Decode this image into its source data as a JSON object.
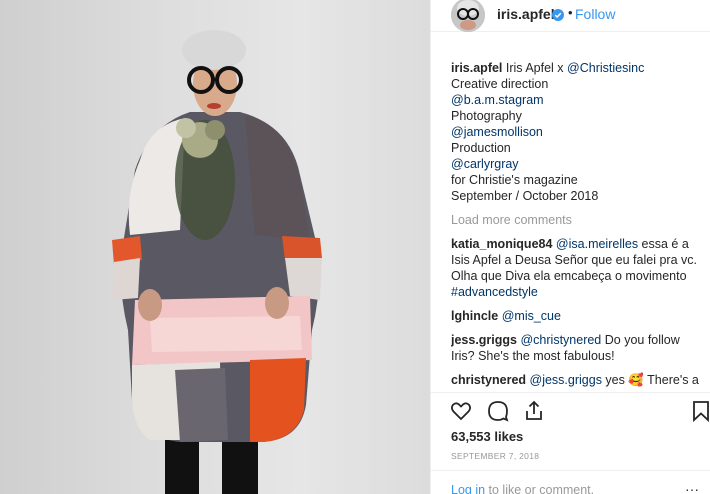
{
  "post": {
    "username": "iris.apfel",
    "follow_label": "Follow",
    "dot": "•"
  },
  "caption": {
    "user": "iris.apfel",
    "line1": " Iris Apfel x ",
    "mention1": "@Christiesinc",
    "line2": "Creative direction",
    "mention2": "@b.a.m.stagram",
    "line3": "Photography",
    "mention3": "@jamesmollison",
    "line4": "Production",
    "mention4": "@carlyrgray",
    "line5": "for Christie's magazine",
    "line6": "September / October 2018"
  },
  "load_more": "Load more comments",
  "comments": [
    {
      "user": "katia_monique84",
      "mention": "@isa.meirelles",
      "text": " essa é a Isis Apfel a Deusa Señor que eu falei pra vc. Olha que Diva ela emcabeça o movimento ",
      "tag": "#advancedstyle"
    },
    {
      "user": "lghincle",
      "mention": "@mis_cue",
      "text": "",
      "tag": ""
    },
    {
      "user": "jess.griggs",
      "mention": "@christynered",
      "text": " Do you follow Iris? She's the most fabulous!",
      "tag": ""
    },
    {
      "user": "christynered",
      "mention": "@jess.griggs",
      "text": " yes 🥰 There's a great documentary on Netflix about her!",
      "tag": ""
    }
  ],
  "likes": "63,553 likes",
  "date": "SEPTEMBER 7, 2018",
  "login": {
    "link": "Log in",
    "text": " to like or comment."
  },
  "colors": {
    "link": "#3897f0",
    "mention": "#003569",
    "muted": "#999999",
    "verified": "#3897f0"
  },
  "icons": [
    "heart-icon",
    "comment-icon",
    "share-icon",
    "bookmark-icon",
    "verified-badge-icon",
    "more-icon"
  ]
}
